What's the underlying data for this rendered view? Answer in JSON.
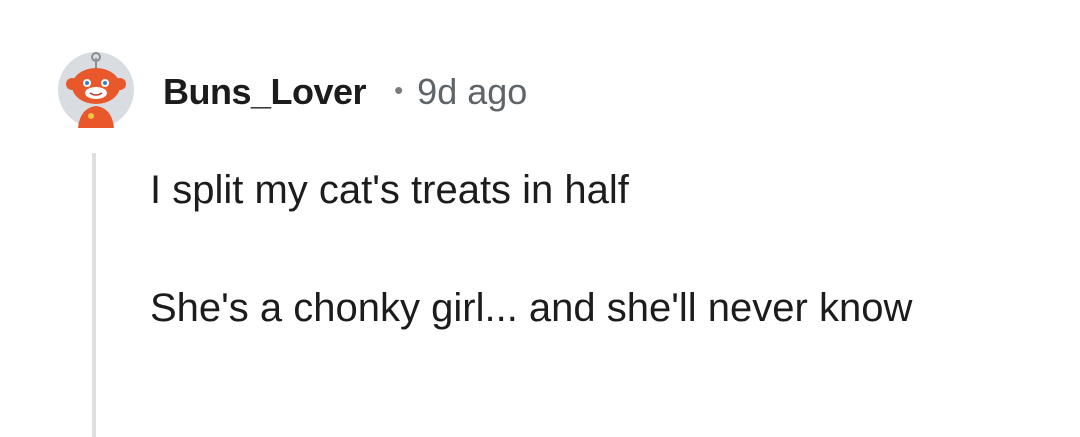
{
  "comment": {
    "author": "Buns_Lover",
    "separator": "•",
    "time_ago": "9d ago",
    "avatar_icon": "snoo-avatar-icon",
    "paragraphs": [
      "I split my cat's treats in half",
      "She's a chonky girl... and she'll never know"
    ]
  },
  "colors": {
    "avatar_orange": "#e8582a",
    "avatar_bg": "#d9dde2",
    "thread_line": "#dcdee0",
    "username": "#1c1c1c",
    "meta": "#5f6468"
  }
}
